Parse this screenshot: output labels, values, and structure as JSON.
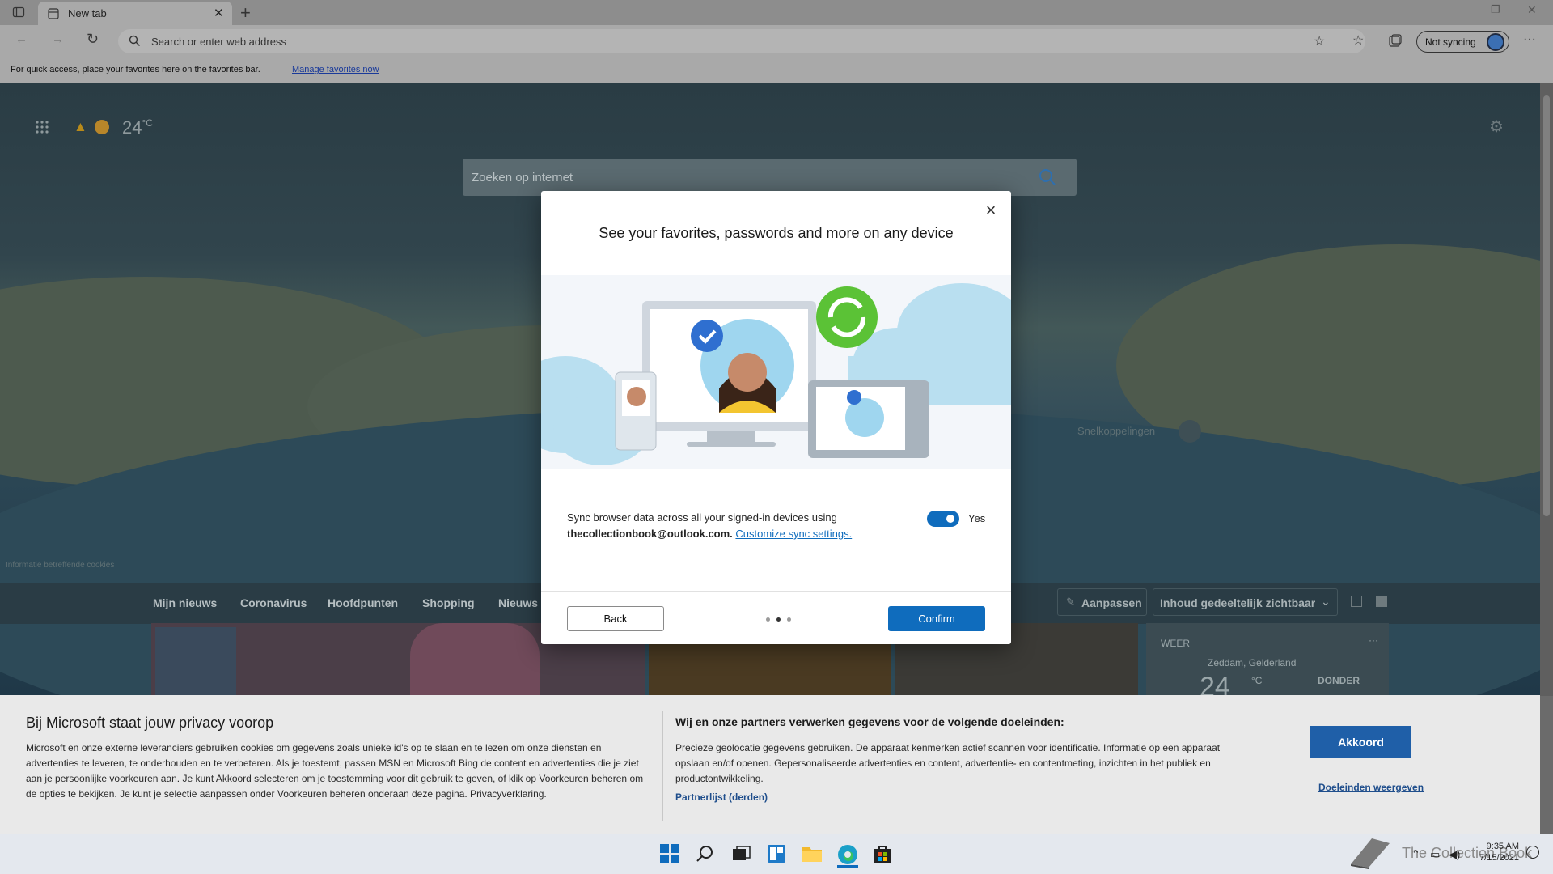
{
  "tab": {
    "title": "New tab"
  },
  "address_bar": {
    "placeholder": "Search or enter web address"
  },
  "favorites_bar": {
    "message": "For quick access, place your favorites here on the favorites bar.",
    "link": "Manage favorites now"
  },
  "profile": {
    "sync_label": "Not syncing"
  },
  "weather": {
    "temp": "24",
    "unit": "°C"
  },
  "page_search": {
    "placeholder": "Zoeken op internet"
  },
  "quick_links_label": "Snelkoppelingen",
  "cookie_info": "Informatie betreffende cookies",
  "feed": {
    "tabs": [
      "Mijn nieuws",
      "Coronavirus",
      "Hoofdpunten",
      "Shopping",
      "Nieuws"
    ],
    "customize": "Aanpassen",
    "content_visibility": "Inhoud gedeeltelijk zichtbaar",
    "weather_card": {
      "heading": "WEER",
      "location": "Zeddam, Gelderland",
      "temp": "24",
      "unit": "°C",
      "alert": "DONDER"
    }
  },
  "dialog": {
    "title": "See your favorites, passwords and more on any device",
    "sync_text": "Sync browser data across all your signed-in devices using",
    "email": "thecollectionbook@outlook.com.",
    "customize_link": "Customize sync settings.",
    "toggle_label": "Yes",
    "toggle_on": true,
    "back_label": "Back",
    "confirm_label": "Confirm",
    "step": 2,
    "steps": 3
  },
  "privacy": {
    "heading": "Bij Microsoft staat jouw privacy voorop",
    "body": "Microsoft en onze externe leveranciers gebruiken cookies om gegevens zoals unieke id's op te slaan en te lezen om onze diensten en advertenties te leveren, te onderhouden en te verbeteren. Als je toestemt, passen MSN en Microsoft Bing de content en advertenties die je ziet aan je persoonlijke voorkeuren aan. Je kunt Akkoord selecteren om je toestemming voor dit gebruik te geven, of klik op Voorkeuren beheren om de opties te bekijken. Je kunt je selectie aanpassen onder Voorkeuren beheren onderaan deze pagina. Privacyverklaring.",
    "purposes_heading": "Wij en onze partners verwerken gegevens voor de volgende doeleinden:",
    "purposes_body": "Precieze geolocatie gegevens gebruiken. De apparaat kenmerken actief scannen voor identificatie. Informatie op een apparaat opslaan en/of openen. Gepersonaliseerde advertenties en content, advertentie- en contentmeting, inzichten in het publiek en productontwikkeling.",
    "partner_link": "Partnerlijst (derden)",
    "accept": "Akkoord",
    "show_purposes": "Doeleinden weergeven"
  },
  "taskbar": {
    "time": "9:35 AM",
    "date": "7/15/2021"
  },
  "watermark": "The Collection Book",
  "colors": {
    "accent": "#0f6cbd",
    "overlay_button": "#1f5fa8"
  }
}
